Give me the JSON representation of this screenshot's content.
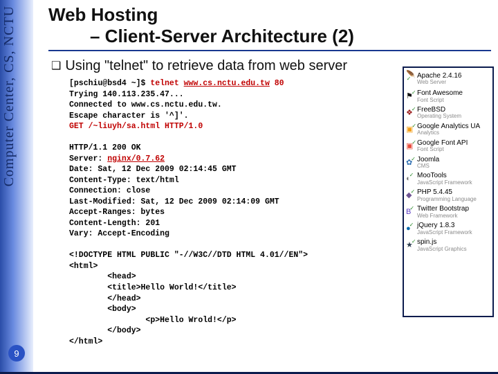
{
  "leftbar": {
    "label": "Computer Center, CS, NCTU"
  },
  "page_number": "9",
  "title_line1": "Web Hosting",
  "title_line2": "– Client-Server Architecture (2)",
  "bullet": "Using \"telnet\" to retrieve data from web server",
  "code": {
    "l1a": "[pschiu@bsd4 ~]$ ",
    "l1b": "telnet ",
    "l1c": "www.cs.nctu.edu.tw",
    "l1d": " 80",
    "l2": "Trying 140.113.235.47...",
    "l3": "Connected to www.cs.nctu.edu.tw.",
    "l4": "Escape character is '^]'.",
    "l5": "GET /~liuyh/sa.html HTTP/1.0",
    "l6": "HTTP/1.1 200 OK",
    "l7a": "Server: ",
    "l7b": "nginx/0.7.62",
    "l8": "Date: Sat, 12 Dec 2009 02:14:45 GMT",
    "l9": "Content-Type: text/html",
    "l10": "Connection: close",
    "l11": "Last-Modified: Sat, 12 Dec 2009 02:14:09 GMT",
    "l12": "Accept-Ranges: bytes",
    "l13": "Content-Length: 201",
    "l14": "Vary: Accept-Encoding",
    "l15": "<!DOCTYPE HTML PUBLIC \"-//W3C//DTD HTML 4.01//EN\">",
    "l16": "<html>",
    "l17": "        <head>",
    "l18": "        <title>Hello World!</title>",
    "l19": "        </head>",
    "l20": "        <body>",
    "l21": "                <p>Hello Wrold!</p>",
    "l22": "        </body>",
    "l23": "</html>"
  },
  "side": {
    "items": [
      {
        "glyph": "🪶",
        "glyphColor": "#c0392b",
        "name": "Apache 2.4.16",
        "cat": "Web Server"
      },
      {
        "glyph": "⚑",
        "glyphColor": "#111",
        "name": "Font Awesome",
        "cat": "Font Script"
      },
      {
        "glyph": "❖",
        "glyphColor": "#9a1b1b",
        "name": "FreeBSD",
        "cat": "Operating System"
      },
      {
        "glyph": "�Color",
        "glyphColor": "#f39c12",
        "name": "Google Analytics UA",
        "cat": "Analytics"
      },
      {
        "glyph": "▣",
        "glyphColor": "#e74c3c",
        "name": "Google Font API",
        "cat": "Font Script"
      },
      {
        "glyph": "✿",
        "glyphColor": "#2b6cb0",
        "name": "Joomla",
        "cat": "CMS"
      },
      {
        "glyph": "◐",
        "glyphColor": "#7a7a7a",
        "name": "MooTools",
        "cat": "JavaScript Framework"
      },
      {
        "glyph": "◆",
        "glyphColor": "#6e5494",
        "name": "PHP 5.4.45",
        "cat": "Programming Language"
      },
      {
        "glyph": "B",
        "glyphColor": "#5b3cc4",
        "name": "Twitter Bootstrap",
        "cat": "Web Framework"
      },
      {
        "glyph": "●",
        "glyphColor": "#0769ad",
        "name": "jQuery 1.8.3",
        "cat": "JavaScript Framework"
      },
      {
        "glyph": "★",
        "glyphColor": "#2c3e50",
        "name": "spin.js",
        "cat": "JavaScript Graphics"
      }
    ]
  }
}
